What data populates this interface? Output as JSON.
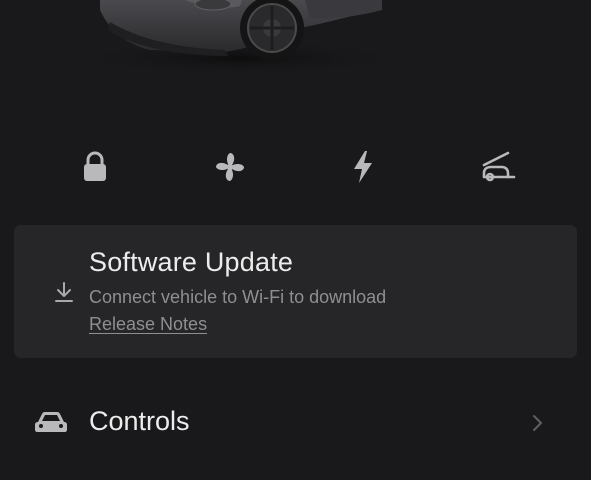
{
  "colors": {
    "background": "#19191b",
    "card": "#262628",
    "icon": "#b9b9bb",
    "text_primary": "#ececec",
    "text_secondary": "#8f8f92"
  },
  "vehicle_image": {
    "icon": "car-render-icon"
  },
  "quick_actions": [
    {
      "icon": "lock-icon"
    },
    {
      "icon": "fan-icon"
    },
    {
      "icon": "charging-bolt-icon"
    },
    {
      "icon": "frunk-icon"
    }
  ],
  "software_update": {
    "icon": "download-icon",
    "title": "Software Update",
    "subtitle": "Connect vehicle to Wi-Fi to download",
    "link": "Release Notes"
  },
  "menu": {
    "controls": {
      "icon": "car-icon",
      "label": "Controls",
      "chevron": "chevron-right-icon"
    }
  }
}
